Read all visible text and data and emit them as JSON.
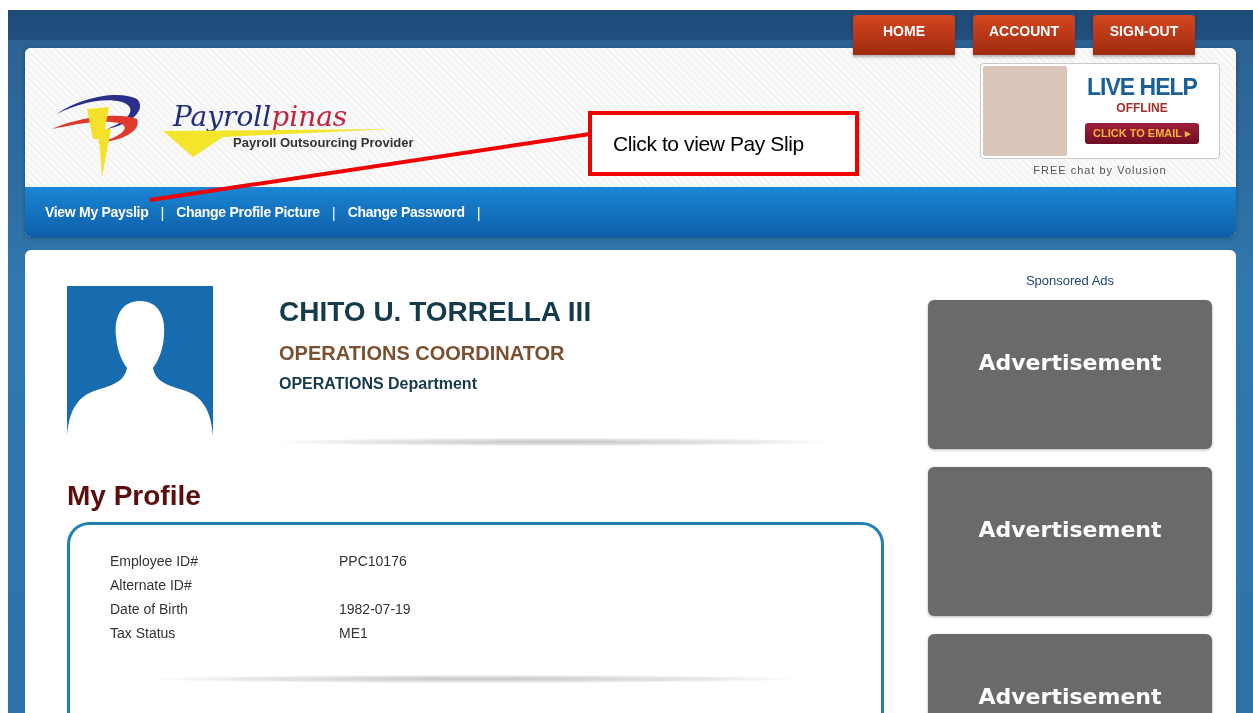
{
  "top_nav": [
    {
      "label": "HOME"
    },
    {
      "label": "ACCOUNT"
    },
    {
      "label": "SIGN-OUT"
    }
  ],
  "logo": {
    "name_part1": "Payroll",
    "name_part2": "pinas",
    "tagline": "Payroll Outsourcing Provider"
  },
  "callout": {
    "text": "Click to view Pay Slip"
  },
  "live_help": {
    "title": "LIVE HELP",
    "status": "OFFLINE",
    "button": "CLICK TO EMAIL",
    "arrow": "▸",
    "credit": "FREE chat by Volusion"
  },
  "sub_nav": [
    {
      "label": "View My Payslip"
    },
    {
      "label": "Change Profile Picture"
    },
    {
      "label": "Change Password"
    }
  ],
  "separator": "|",
  "profile": {
    "name": "CHITO U. TORRELLA III",
    "position": "OPERATIONS COORDINATOR",
    "department": "OPERATIONS Department"
  },
  "section_title": "My Profile",
  "details": [
    {
      "label": "Employee ID#",
      "value": "PPC10176"
    },
    {
      "label": "Alternate ID#"
    },
    {
      "label": "Date of Birth",
      "value": "1982-07-19"
    },
    {
      "label": "Tax Status",
      "value": "ME1"
    }
  ],
  "ads": {
    "heading": "Sponsored Ads",
    "items": [
      "Advertisement",
      "Advertisement",
      "Advertisement"
    ]
  }
}
